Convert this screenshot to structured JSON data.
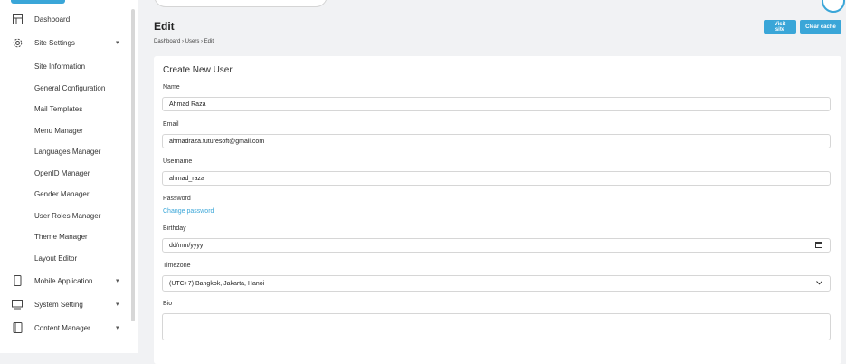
{
  "sidebar": {
    "items": [
      {
        "label": "Dashboard",
        "icon": "dashboard-icon"
      },
      {
        "label": "Site Settings",
        "icon": "gear-icon",
        "caret": "▾"
      },
      {
        "label": "Site Information"
      },
      {
        "label": "General Configuration"
      },
      {
        "label": "Mail Templates"
      },
      {
        "label": "Menu Manager"
      },
      {
        "label": "Languages Manager"
      },
      {
        "label": "OpenID Manager"
      },
      {
        "label": "Gender Manager"
      },
      {
        "label": "User Roles Manager"
      },
      {
        "label": "Theme Manager"
      },
      {
        "label": "Layout Editor"
      },
      {
        "label": "Mobile Application",
        "icon": "mobile-icon",
        "caret": "▾"
      },
      {
        "label": "System Setting",
        "icon": "monitor-icon",
        "caret": "▾"
      },
      {
        "label": "Content Manager",
        "icon": "content-icon",
        "caret": "▾"
      }
    ]
  },
  "header": {
    "title": "Edit",
    "breadcrumb": "Dashboard  ›  Users  ›  Edit",
    "visit_site": "Visit site",
    "clear_cache": "Clear cache"
  },
  "form": {
    "title": "Create New User",
    "name_label": "Name",
    "name_value": "Ahmad Raza",
    "email_label": "Email",
    "email_value": "ahmadraza.futuresoft@gmail.com",
    "username_label": "Username",
    "username_value": "ahmad_raza",
    "password_label": "Password",
    "change_password": "Change password",
    "birthday_label": "Birthday",
    "birthday_placeholder": "dd/mm/yyyy",
    "timezone_label": "Timezone",
    "timezone_value": "(UTC+7) Bangkok, Jakarta, Hanoi",
    "bio_label": "Bio"
  },
  "colors": {
    "accent": "#3aa6d8",
    "background": "#f1f2f4"
  }
}
